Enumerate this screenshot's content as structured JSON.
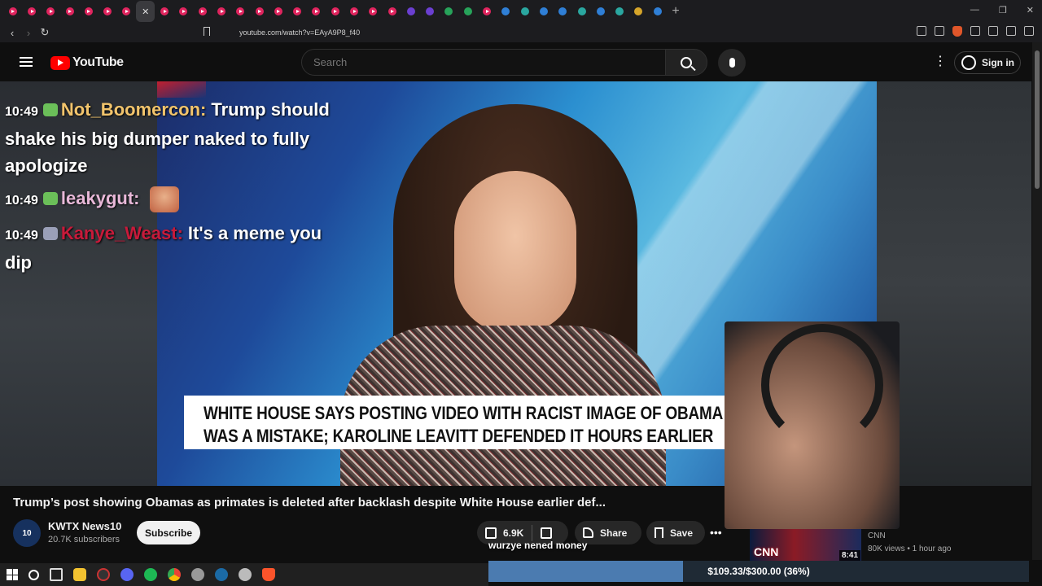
{
  "browser": {
    "tab_count": 35,
    "active_tab_index": 7,
    "url": "youtube.com/watch?v=EAyA9P8_f40",
    "active_tab_close": "✕",
    "new_tab": "+"
  },
  "youtube": {
    "logo_text": "YouTube",
    "search_placeholder": "Search",
    "signin_label": "Sign in"
  },
  "overlay_chat": [
    {
      "time": "10:49",
      "user": "Not_Boomercon:",
      "user_color": "#f2c46c",
      "badge_color": "#6bbf59",
      "text": "Trump should shake his big dumper naked to fully apologize"
    },
    {
      "time": "10:49",
      "user": "leakygut:",
      "user_color": "#e8b8d8",
      "badge_color": "#6bbf59",
      "text": ""
    },
    {
      "time": "10:49",
      "user": "Kanye_Weast:",
      "user_color": "#c81a3a",
      "badge_color": "#9aa0b8",
      "text": "It's a meme you dip"
    }
  ],
  "video": {
    "lower_third_line1": "WHITE HOUSE SAYS POSTING VIDEO WITH RACIST IMAGE OF OBAMA",
    "lower_third_line2": "WAS A MISTAKE; KAROLINE LEAVITT DEFENDED IT HOURS EARLIER",
    "title": "Trump’s post showing Obamas as primates is deleted after backlash despite White House earlier def..."
  },
  "channel": {
    "avatar_text": "10",
    "name": "KWTX News10",
    "subscribers": "20.7K subscribers",
    "subscribe_label": "Subscribe"
  },
  "actions": {
    "likes": "6.9K",
    "share_label": "Share",
    "save_label": "Save",
    "more": "•••"
  },
  "sidebar_video": {
    "channel": "CNN",
    "meta": "80K views • 1 hour ago",
    "duration": "8:41",
    "logo": "CNN"
  },
  "stream_overlay": {
    "caption": "wurzye nened money",
    "goal_text": "$109.33/$300.00 (36%)",
    "goal_fraction": 0.36
  },
  "icons": {
    "hamburger": "hamburger-menu-icon",
    "search": "search-icon",
    "mic": "microphone-icon",
    "kebab": "more-vert-icon",
    "account": "account-circle-icon",
    "like": "thumb-up-icon",
    "dislike": "thumb-down-icon",
    "share": "share-icon",
    "save": "bookmark-icon"
  }
}
